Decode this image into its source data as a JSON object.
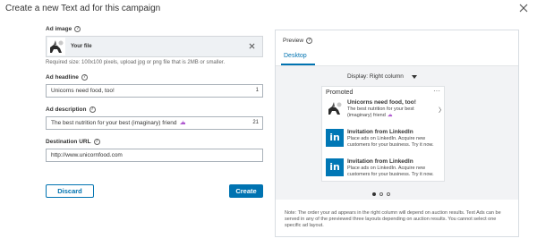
{
  "header": {
    "title": "Create a new Text ad for this campaign"
  },
  "form": {
    "ad_image": {
      "label": "Ad image",
      "file_name": "Your file",
      "hint": "Required size: 100x100 pixels, upload jpg or png file that is 2MB or smaller."
    },
    "headline": {
      "label": "Ad headline",
      "value": "Unicorns need food, too!",
      "count": "1"
    },
    "description": {
      "label": "Ad description",
      "value": "The best nutrition for your best (imaginary) friend",
      "count": "21"
    },
    "url": {
      "label": "Destination URL",
      "value": "http://www.unicornfood.com"
    }
  },
  "buttons": {
    "discard": "Discard",
    "create": "Create"
  },
  "preview": {
    "title": "Preview",
    "tab": "Desktop",
    "display": "Display: Right column",
    "card": {
      "promoted": "Promoted",
      "ads": [
        {
          "headline": "Unicorns need food, too!",
          "body": "The best nutrition for your best (imaginary) friend"
        },
        {
          "headline": "Invitation from LinkedIn",
          "body": "Place ads on LinkedIn. Acquire new customers for your business. Try it now."
        },
        {
          "headline": "Invitation from LinkedIn",
          "body": "Place ads on LinkedIn. Acquire new customers for your business. Try it now."
        }
      ]
    },
    "pagination": {
      "total": 3,
      "active": 1
    },
    "note": "Note: The order your ad appears in the right column will depend on auction results. Text Ads can be served in any of the previewed three layouts depending on auction results. You cannot select one specific ad layout."
  },
  "colors": {
    "accent": "#0073b1",
    "linkedin": "#0077b5"
  }
}
